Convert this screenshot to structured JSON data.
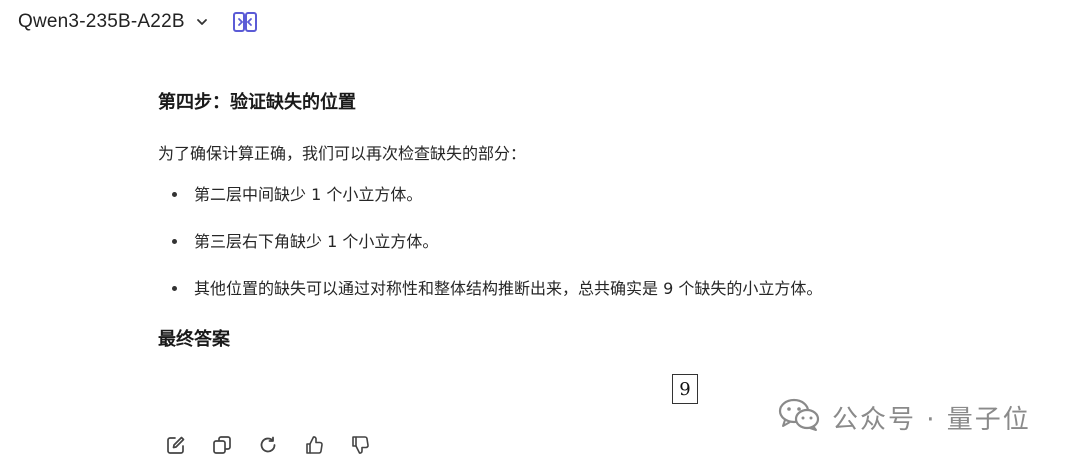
{
  "header": {
    "model_name": "Qwen3-235B-A22B"
  },
  "message": {
    "step_title": "第四步：验证缺失的位置",
    "intro": "为了确保计算正确，我们可以再次检查缺失的部分：",
    "bullets": [
      "第二层中间缺少 1 个小立方体。",
      "第三层右下角缺少 1 个小立方体。",
      "其他位置的缺失可以通过对称性和整体结构推断出来，总共确实是 9 个缺失的小立方体。"
    ],
    "final_title": "最终答案",
    "final_answer": "9"
  },
  "actions": {
    "icons": [
      "edit-icon",
      "copy-icon",
      "regenerate-icon",
      "thumbs-up-icon",
      "thumbs-down-icon"
    ]
  },
  "watermark": {
    "text": "公众号 · 量子位"
  },
  "colors": {
    "accent": "#5b5bd6",
    "icon_gray": "#444444",
    "watermark_gray": "#8a8a8a"
  }
}
